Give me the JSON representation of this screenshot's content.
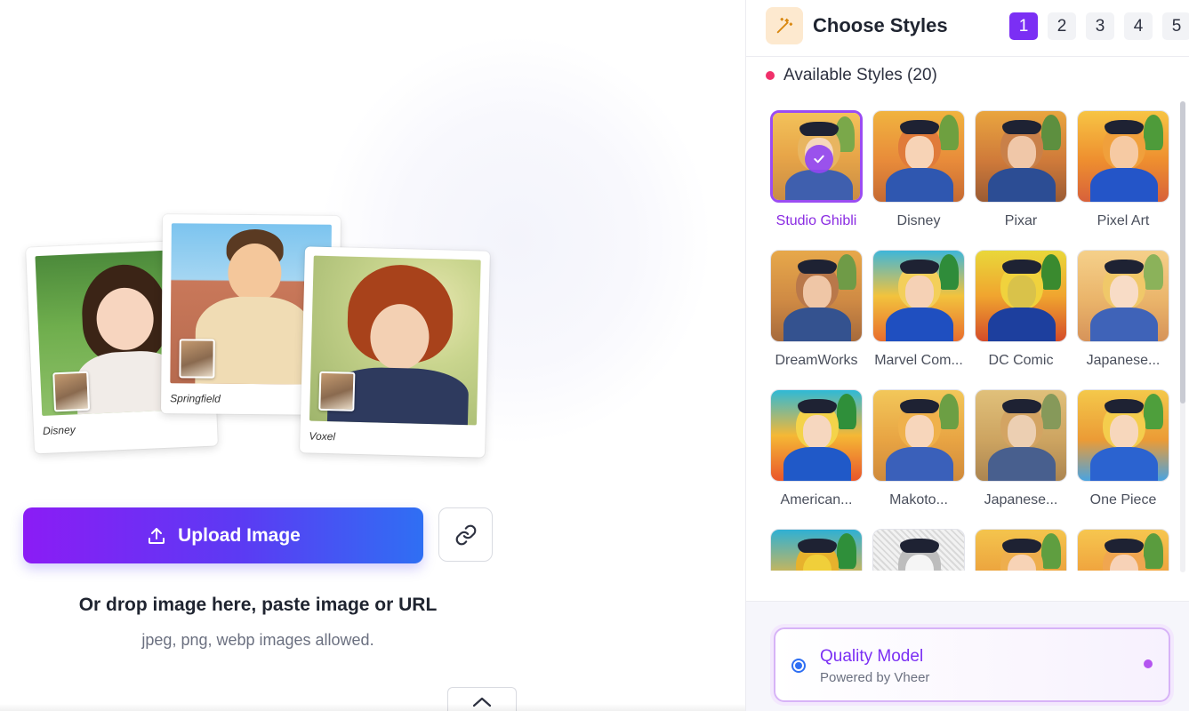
{
  "upload": {
    "button_label": "Upload Image",
    "drop_text": "Or drop image here, paste image or URL",
    "allowed_text": "jpeg, png, webp images allowed."
  },
  "preview_cards": [
    {
      "caption": "Disney"
    },
    {
      "caption": "Springfield"
    },
    {
      "caption": "Voxel"
    }
  ],
  "style_panel": {
    "title": "Choose Styles",
    "steps": [
      "1",
      "2",
      "3",
      "4",
      "5"
    ],
    "active_step": "1",
    "available_label": "Available Styles (20)",
    "styles": [
      {
        "label": "Studio Ghibli",
        "selected": true
      },
      {
        "label": "Disney"
      },
      {
        "label": "Pixar"
      },
      {
        "label": "Pixel Art"
      },
      {
        "label": "DreamWorks"
      },
      {
        "label": "Marvel Com..."
      },
      {
        "label": "DC Comic"
      },
      {
        "label": "Japanese..."
      },
      {
        "label": "American..."
      },
      {
        "label": "Makoto..."
      },
      {
        "label": "Japanese..."
      },
      {
        "label": "One Piece"
      },
      {
        "label": ""
      },
      {
        "label": ""
      },
      {
        "label": ""
      },
      {
        "label": ""
      }
    ]
  },
  "model": {
    "title": "Quality Model",
    "subtitle": "Powered by Vheer"
  },
  "colors": {
    "accent": "#7b2ff4",
    "button_gradient_start": "#8b1cf5",
    "button_gradient_end": "#2f6ff3",
    "status_dot": "#f0306a"
  }
}
